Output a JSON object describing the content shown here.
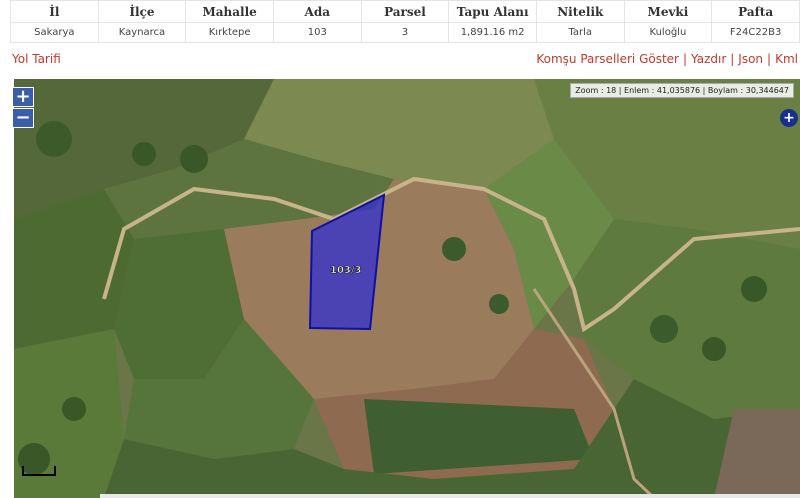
{
  "table": {
    "headers": [
      "İl",
      "İlçe",
      "Mahalle",
      "Ada",
      "Parsel",
      "Tapu Alanı",
      "Nitelik",
      "Mevki",
      "Pafta"
    ],
    "row": [
      "Sakarya",
      "Kaynarca",
      "Kırktepe",
      "103",
      "3",
      "1,891.16 m2",
      "Tarla",
      "Kuloğlu",
      "F24C22B3"
    ]
  },
  "links": {
    "yol_tarifi": "Yol Tarifi",
    "komsu": "Komşu Parselleri Göster",
    "yazdir": "Yazdır",
    "json": "Json",
    "kml": "Kml",
    "separator": "|"
  },
  "map": {
    "zoom_in": "+",
    "zoom_out": "−",
    "coords": "Zoom : 18 | Enlem : 41,035876 | Boylam : 30,344647",
    "layer_switcher": "+",
    "parcel_label": "103/3",
    "parcel_color": "#2a2ad8"
  }
}
